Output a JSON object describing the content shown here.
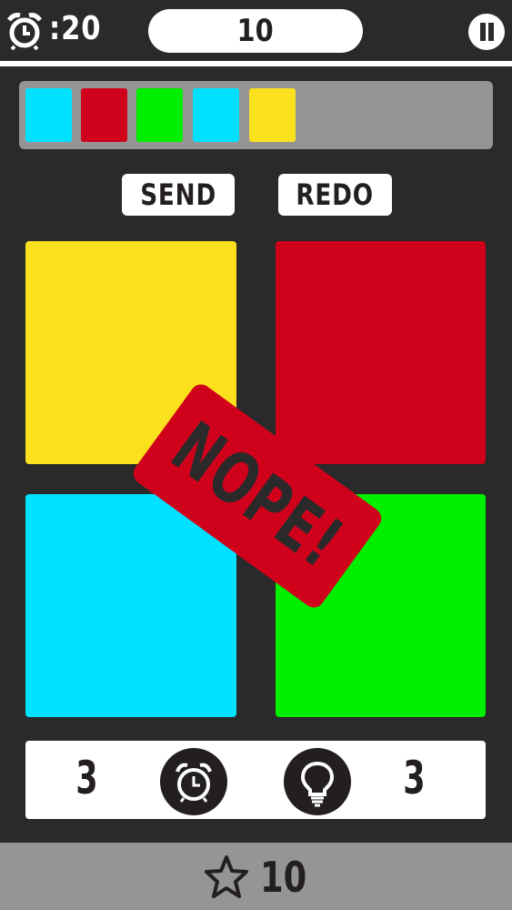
{
  "hud": {
    "timer": ":20",
    "score": "10"
  },
  "sequence": {
    "colors": [
      "#00e1ff",
      "#d0021b",
      "#00ee00",
      "#00e1ff",
      "#fbe01e"
    ]
  },
  "actions": {
    "send_label": "SEND",
    "redo_label": "REDO"
  },
  "pads": {
    "yellow": "#fbe01e",
    "red": "#d0021b",
    "cyan": "#00e1ff",
    "green": "#00ee00"
  },
  "feedback": {
    "stamp_text": "NOPE!"
  },
  "powerups": {
    "time_count": "3",
    "hint_count": "3",
    "time_icon": "alarm-clock-icon",
    "hint_icon": "lightbulb-icon"
  },
  "footer": {
    "stars": "10"
  },
  "colors": {
    "background": "#2b2a2b",
    "panel_gray": "#959595",
    "white": "#ffffff",
    "ink": "#231f20"
  }
}
